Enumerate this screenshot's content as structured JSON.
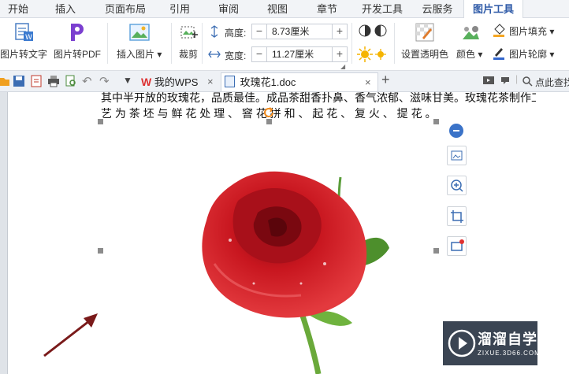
{
  "menu": {
    "tabs": [
      "开始",
      "插入",
      "页面布局",
      "引用",
      "审阅",
      "视图",
      "章节",
      "开发工具",
      "云服务",
      "图片工具"
    ],
    "active": "图片工具"
  },
  "ribbon": {
    "pic_to_text": "图片转文字",
    "pic_to_pdf": "图片转PDF",
    "insert_picture": "插入图片",
    "crop": "裁剪",
    "height_label": "高度:",
    "height_value": "8.73厘米",
    "width_label": "宽度:",
    "width_value": "11.27厘米",
    "set_transparent": "设置透明色",
    "color": "颜色",
    "pic_fill": "图片填充",
    "pic_outline": "图片轮廓",
    "minus": "−",
    "plus": "+"
  },
  "doc_tabs": {
    "wps_tab": "我的WPS",
    "doc_tab": "玫瑰花1.doc",
    "close": "×",
    "new_tab": "+",
    "search": "点此查找"
  },
  "document": {
    "line1": "其中半开放的玫瑰花，品质最佳。成品茶甜香扑鼻、香气浓郁、滋味甘美。玫瑰花茶制作工",
    "line2": "艺 为 茶 坯 与 鲜 花 处 理 、 窨 花 拼 和 、 起 花 、 复 火 、 提 花 。"
  },
  "watermark": {
    "title": "溜溜自学",
    "url": "ZIXUE.3D66.COM"
  },
  "colors": {
    "accent": "#2f5ba8",
    "rose": "#c4161c",
    "arrow": "#7a1a1a"
  }
}
